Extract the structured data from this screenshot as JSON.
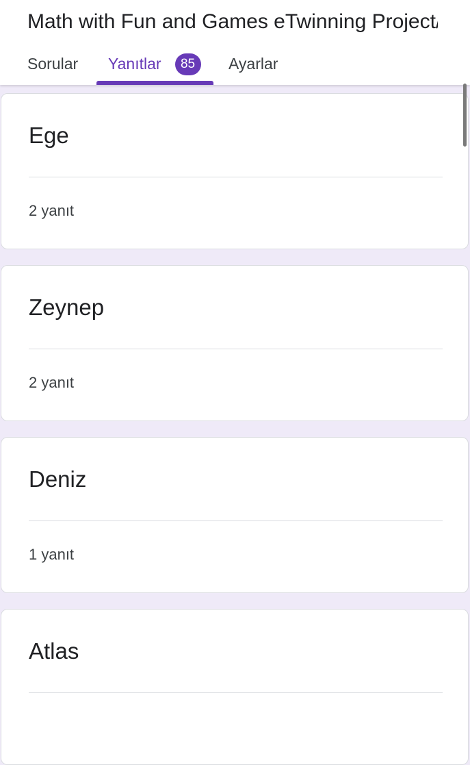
{
  "form": {
    "title": "Math with Fun and Games eTwinning Project/"
  },
  "tabs": [
    {
      "label": "Sorular"
    },
    {
      "label": "Yanıtlar",
      "badge": "85"
    },
    {
      "label": "Ayarlar"
    }
  ],
  "colors": {
    "accent": "#673ab7",
    "background": "#efeaf8"
  },
  "responses": [
    {
      "name": "Ege",
      "count": "2 yanıt"
    },
    {
      "name": "Zeynep",
      "count": "2 yanıt"
    },
    {
      "name": "Deniz",
      "count": "1 yanıt"
    },
    {
      "name": "Atlas",
      "count": ""
    }
  ]
}
